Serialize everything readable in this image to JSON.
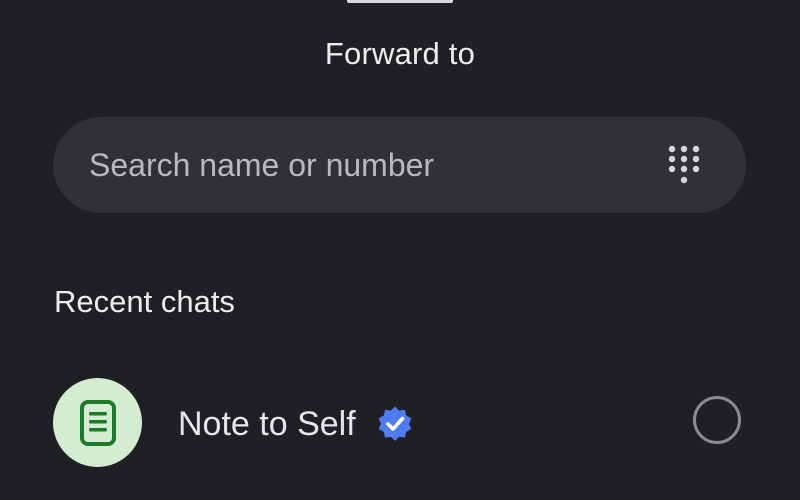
{
  "header": {
    "title": "Forward to"
  },
  "search": {
    "placeholder": "Search name or number",
    "value": ""
  },
  "icons": {
    "dialpad": "dialpad-icon",
    "note": "note-icon",
    "verified": "verified-badge-icon"
  },
  "recent": {
    "label": "Recent chats",
    "items": [
      {
        "name": "Note to Self",
        "verified": true,
        "selected": false
      }
    ]
  },
  "colors": {
    "background": "#1f2024",
    "search_bg": "#303134",
    "avatar_bg": "#d3ecd2",
    "avatar_icon": "#1c7a2a",
    "verified": "#4f7cf0"
  }
}
